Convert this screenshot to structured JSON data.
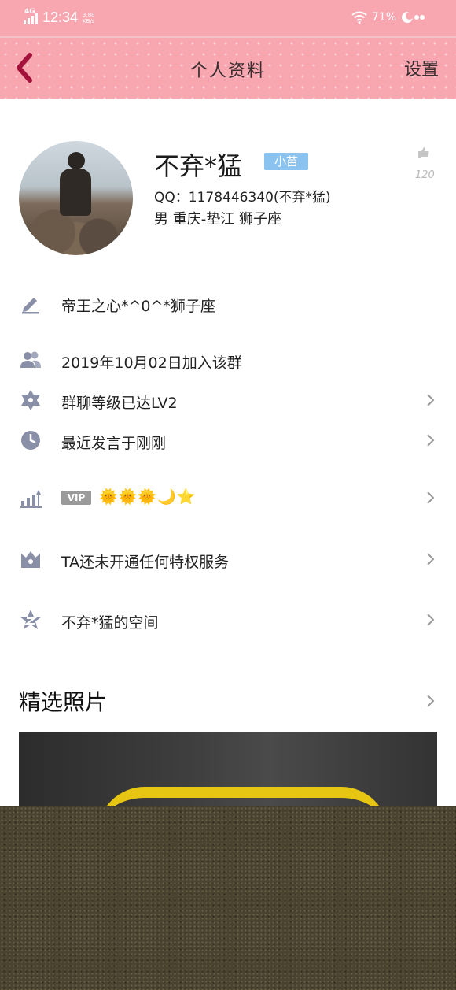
{
  "status_bar": {
    "network": "4G",
    "time": "12:34",
    "speed_value": "3.80",
    "speed_unit": "KB/s",
    "battery": "71%"
  },
  "header": {
    "title": "个人资料",
    "settings_label": "设置"
  },
  "profile": {
    "nickname": "不弃*猛",
    "badge": "小苗",
    "qq_line": "QQ：1178446340(不弃*猛)",
    "info_line": "男 重庆-垫江 狮子座",
    "like_count": "120"
  },
  "rows": {
    "signature": "帝王之心*^0^*狮子座",
    "joined": "2019年10月02日加入该群",
    "level": "群聊等级已达LV2",
    "last_speak": "最近发言于刚刚",
    "vip_tag": "VIP",
    "vip_level_icons": "🌞🌞🌞🌙⭐",
    "privilege": "TA还未开通任何特权服务",
    "space": "不弃*猛的空间"
  },
  "photos": {
    "title": "精选照片"
  },
  "colors": {
    "header_pink": "#f8a7b1",
    "back_arrow": "#a3123a",
    "icon_gray": "#8a8fa8",
    "badge_blue": "#8ac3f0"
  }
}
